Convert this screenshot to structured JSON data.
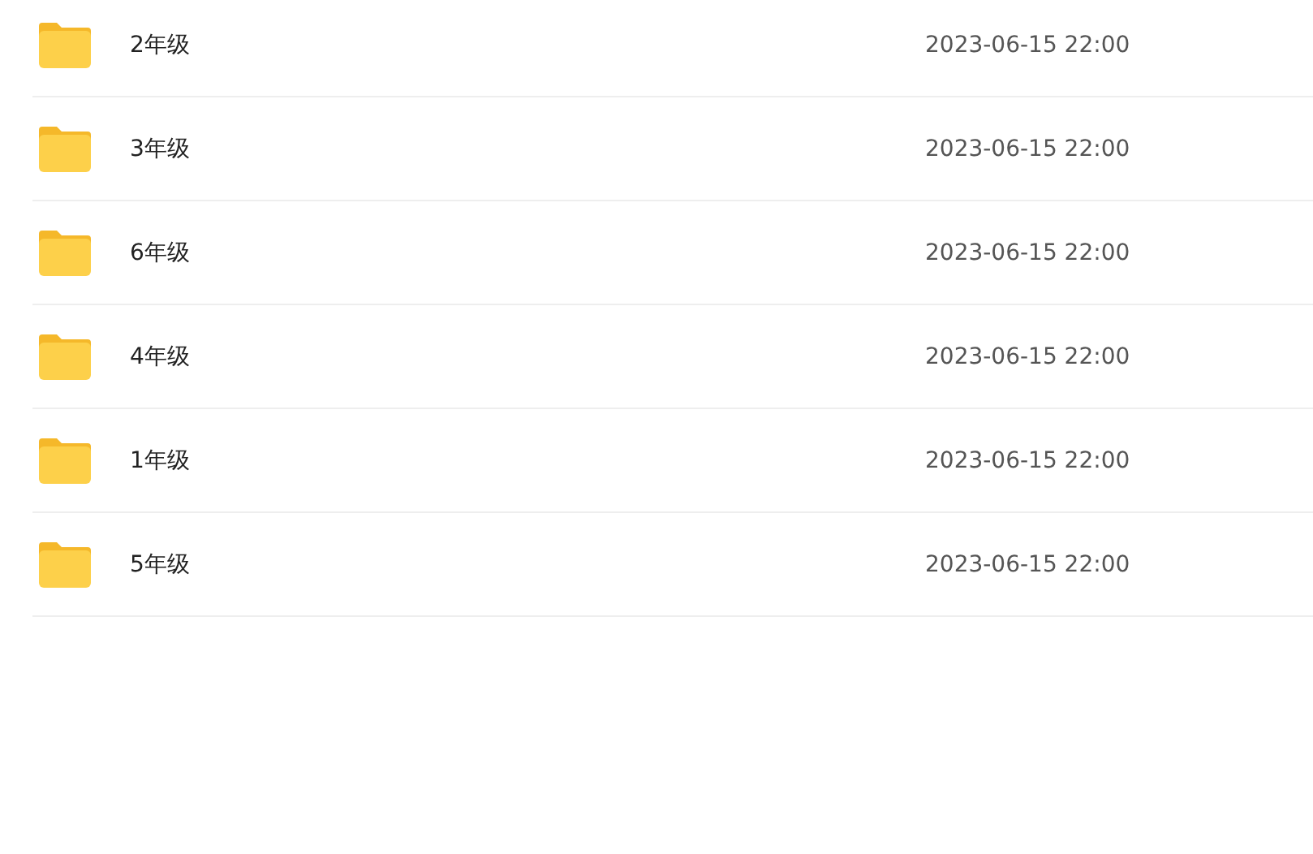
{
  "files": [
    {
      "name": "2年级",
      "modified": "2023-06-15 22:00"
    },
    {
      "name": "3年级",
      "modified": "2023-06-15 22:00"
    },
    {
      "name": "6年级",
      "modified": "2023-06-15 22:00"
    },
    {
      "name": "4年级",
      "modified": "2023-06-15 22:00"
    },
    {
      "name": "1年级",
      "modified": "2023-06-15 22:00"
    },
    {
      "name": "5年级",
      "modified": "2023-06-15 22:00"
    }
  ]
}
